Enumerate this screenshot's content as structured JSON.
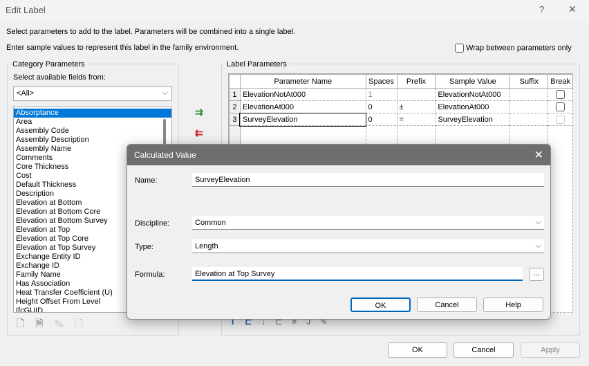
{
  "window": {
    "title": "Edit Label",
    "help": "?",
    "close": "✕"
  },
  "instructions": {
    "line1": "Select parameters to add to the label.  Parameters will be combined into a single label.",
    "line2": "Enter sample values to represent this label in the family environment.",
    "wrap_label": "Wrap between parameters only"
  },
  "category": {
    "title": "Category Parameters",
    "select_label": "Select available fields from:",
    "dropdown_value": "<All>",
    "items": [
      "Absorptance",
      "Area",
      "Assembly Code",
      "Assembly Description",
      "Assembly Name",
      "Comments",
      "Core Thickness",
      "Cost",
      "Default Thickness",
      "Description",
      "Elevation at Bottom",
      "Elevation at Bottom Core",
      "Elevation at Bottom Survey",
      "Elevation at Top",
      "Elevation at Top Core",
      "Elevation at Top Survey",
      "Exchange Entity ID",
      "Exchange ID",
      "Family Name",
      "Has Association",
      "Heat Transfer Coefficient (U)",
      "Height Offset From Level",
      "IfcGUID"
    ],
    "selected": "Absorptance"
  },
  "label_params": {
    "title": "Label Parameters",
    "columns": [
      "",
      "Parameter Name",
      "Spaces",
      "Prefix",
      "Sample Value",
      "Suffix",
      "Break"
    ],
    "rows": [
      {
        "n": "1",
        "name": "ElevationNotAt000",
        "spaces": "1",
        "prefix": "",
        "sample": "ElevationNotAt000",
        "suffix": ""
      },
      {
        "n": "2",
        "name": "ElevationAt000",
        "spaces": "0",
        "prefix": "±",
        "sample": "ElevationAt000",
        "suffix": ""
      },
      {
        "n": "3",
        "name": "SurveyElevation",
        "spaces": "0",
        "prefix": "=",
        "sample": "SurveyElevation",
        "suffix": ""
      }
    ]
  },
  "footer": {
    "ok": "OK",
    "cancel": "Cancel",
    "apply": "Apply"
  },
  "calc": {
    "title": "Calculated Value",
    "name_label": "Name:",
    "name_value": "SurveyElevation",
    "discipline_label": "Discipline:",
    "discipline_value": "Common",
    "type_label": "Type:",
    "type_value": "Length",
    "formula_label": "Formula:",
    "formula_value": "Elevation at Top Survey",
    "browse": "...",
    "ok": "OK",
    "cancel": "Cancel",
    "help": "Help"
  }
}
